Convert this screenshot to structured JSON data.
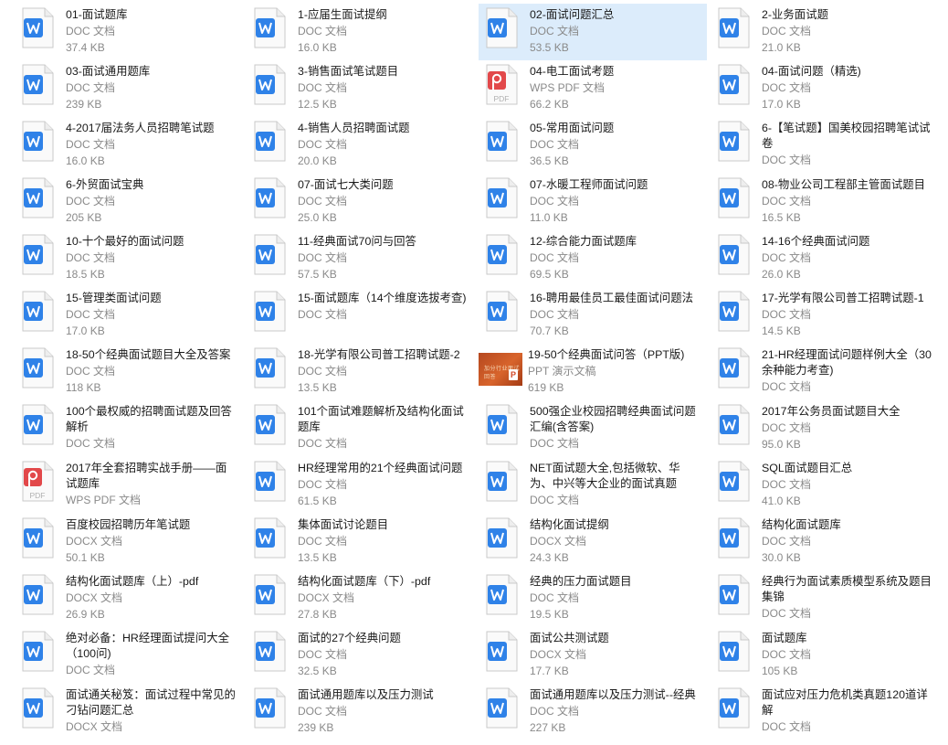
{
  "colors": {
    "selection": "#dcecfb",
    "doc_blue": "#2f82e8",
    "pdf_red": "#e2484a",
    "ppt_orange": "#d24726"
  },
  "files": [
    {
      "name": "01-面试题库",
      "type": "DOC 文档",
      "size": "37.4 KB",
      "icon": "word-doc-icon"
    },
    {
      "name": "1-应届生面试提纲",
      "type": "DOC 文档",
      "size": "16.0 KB",
      "icon": "word-doc-icon"
    },
    {
      "name": "02-面试问题汇总",
      "type": "DOC 文档",
      "size": "53.5 KB",
      "icon": "word-doc-icon",
      "selected": true
    },
    {
      "name": "2-业务面试题",
      "type": "DOC 文档",
      "size": "21.0 KB",
      "icon": "word-doc-icon"
    },
    {
      "name": "03-面试通用题库",
      "type": "DOC 文档",
      "size": "239 KB",
      "icon": "word-doc-icon"
    },
    {
      "name": "3-销售面试笔试题目",
      "type": "DOC 文档",
      "size": "12.5 KB",
      "icon": "word-doc-icon"
    },
    {
      "name": "04-电工面试考题",
      "type": "WPS PDF 文档",
      "size": "66.2 KB",
      "icon": "pdf-icon"
    },
    {
      "name": "04-面试问题（精选)",
      "type": "DOC 文档",
      "size": "17.0 KB",
      "icon": "word-doc-icon"
    },
    {
      "name": "4-2017届法务人员招聘笔试题",
      "type": "DOC 文档",
      "size": "16.0 KB",
      "icon": "word-doc-icon"
    },
    {
      "name": "4-销售人员招聘面试题",
      "type": "DOC 文档",
      "size": "20.0 KB",
      "icon": "word-doc-icon"
    },
    {
      "name": "05-常用面试问题",
      "type": "DOC 文档",
      "size": "36.5 KB",
      "icon": "word-doc-icon"
    },
    {
      "name": "6-【笔试题】国美校园招聘笔试试卷",
      "type": "DOC 文档",
      "size": "",
      "icon": "word-doc-icon"
    },
    {
      "name": "6-外贸面试宝典",
      "type": "DOC 文档",
      "size": "205 KB",
      "icon": "word-doc-icon"
    },
    {
      "name": "07-面试七大类问题",
      "type": "DOC 文档",
      "size": "25.0 KB",
      "icon": "word-doc-icon"
    },
    {
      "name": "07-水暖工程师面试问题",
      "type": "DOC 文档",
      "size": "11.0 KB",
      "icon": "word-doc-icon"
    },
    {
      "name": "08-物业公司工程部主管面试题目",
      "type": "DOC 文档",
      "size": "16.5 KB",
      "icon": "word-doc-icon"
    },
    {
      "name": "10-十个最好的面试问题",
      "type": "DOC 文档",
      "size": "18.5 KB",
      "icon": "word-doc-icon"
    },
    {
      "name": "11-经典面试70问与回答",
      "type": "DOC 文档",
      "size": "57.5 KB",
      "icon": "word-doc-icon"
    },
    {
      "name": "12-综合能力面试题库",
      "type": "DOC 文档",
      "size": "69.5 KB",
      "icon": "word-doc-icon"
    },
    {
      "name": "14-16个经典面试问题",
      "type": "DOC 文档",
      "size": "26.0 KB",
      "icon": "word-doc-icon"
    },
    {
      "name": "15-管理类面试问题",
      "type": "DOC 文档",
      "size": "17.0 KB",
      "icon": "word-doc-icon"
    },
    {
      "name": "15-面试题库（14个维度选拔考查)",
      "type": "DOC 文档",
      "size": "",
      "icon": "word-doc-icon"
    },
    {
      "name": "16-聘用最佳员工最佳面试问题法",
      "type": "DOC 文档",
      "size": "70.7 KB",
      "icon": "word-doc-icon"
    },
    {
      "name": "17-光学有限公司普工招聘试题-1",
      "type": "DOC 文档",
      "size": "14.5 KB",
      "icon": "word-doc-icon"
    },
    {
      "name": "18-50个经典面试题目大全及答案",
      "type": "DOC 文档",
      "size": "118 KB",
      "icon": "word-doc-icon"
    },
    {
      "name": "18-光学有限公司普工招聘试题-2",
      "type": "DOC 文档",
      "size": "13.5 KB",
      "icon": "word-doc-icon"
    },
    {
      "name": "19-50个经典面试问答（PPT版)",
      "type": "PPT 演示文稿",
      "size": "619 KB",
      "icon": "ppt-thumbnail-icon"
    },
    {
      "name": "21-HR经理面试问题样例大全（30余种能力考查)",
      "type": "DOC 文档",
      "size": "",
      "icon": "word-doc-icon"
    },
    {
      "name": "100个最权威的招聘面试题及回答解析",
      "type": "DOC 文档",
      "size": "",
      "icon": "word-doc-icon"
    },
    {
      "name": "101个面试难题解析及结构化面试题库",
      "type": "DOC 文档",
      "size": "",
      "icon": "word-doc-icon"
    },
    {
      "name": "500强企业校园招聘经典面试问题汇编(含答案)",
      "type": "DOC 文档",
      "size": "",
      "icon": "word-doc-icon"
    },
    {
      "name": "2017年公务员面试题目大全",
      "type": "DOC 文档",
      "size": "95.0 KB",
      "icon": "word-doc-icon"
    },
    {
      "name": "2017年全套招聘实战手册——面试题库",
      "type": "WPS PDF 文档",
      "size": "",
      "icon": "pdf-icon"
    },
    {
      "name": "HR经理常用的21个经典面试问题",
      "type": "DOC 文档",
      "size": "61.5 KB",
      "icon": "word-doc-icon"
    },
    {
      "name": "NET面试题大全,包括微软、华为、中兴等大企业的面试真题",
      "type": "DOC 文档",
      "size": "",
      "icon": "word-doc-icon"
    },
    {
      "name": "SQL面试题目汇总",
      "type": "DOC 文档",
      "size": "41.0 KB",
      "icon": "word-doc-icon"
    },
    {
      "name": "百度校园招聘历年笔试题",
      "type": "DOCX 文档",
      "size": "50.1 KB",
      "icon": "word-docx-icon"
    },
    {
      "name": "集体面试讨论题目",
      "type": "DOC 文档",
      "size": "13.5 KB",
      "icon": "word-doc-icon"
    },
    {
      "name": "结构化面试提纲",
      "type": "DOCX 文档",
      "size": "24.3 KB",
      "icon": "word-docx-icon"
    },
    {
      "name": "结构化面试题库",
      "type": "DOC 文档",
      "size": "30.0 KB",
      "icon": "word-doc-icon"
    },
    {
      "name": "结构化面试题库（上）-pdf",
      "type": "DOCX 文档",
      "size": "26.9 KB",
      "icon": "word-docx-icon"
    },
    {
      "name": "结构化面试题库（下）-pdf",
      "type": "DOCX 文档",
      "size": "27.8 KB",
      "icon": "word-docx-icon"
    },
    {
      "name": "经典的压力面试题目",
      "type": "DOC 文档",
      "size": "19.5 KB",
      "icon": "word-doc-icon"
    },
    {
      "name": "经典行为面试素质模型系统及题目集锦",
      "type": "DOC 文档",
      "size": "",
      "icon": "word-doc-icon"
    },
    {
      "name": "绝对必备：HR经理面试提问大全（100问)",
      "type": "DOC 文档",
      "size": "",
      "icon": "word-doc-icon"
    },
    {
      "name": "面试的27个经典问题",
      "type": "DOC 文档",
      "size": "32.5 KB",
      "icon": "word-doc-icon"
    },
    {
      "name": "面试公共测试题",
      "type": "DOCX 文档",
      "size": "17.7 KB",
      "icon": "word-docx-icon"
    },
    {
      "name": "面试题库",
      "type": "DOC 文档",
      "size": "105 KB",
      "icon": "word-doc-icon"
    },
    {
      "name": "面试通关秘笈：面试过程中常见的刁钻问题汇总",
      "type": "DOCX 文档",
      "size": "",
      "icon": "word-docx-icon"
    },
    {
      "name": "面试通用题库以及压力测试",
      "type": "DOC 文档",
      "size": "239 KB",
      "icon": "word-doc-icon"
    },
    {
      "name": "面试通用题库以及压力测试--经典",
      "type": "DOC 文档",
      "size": "227 KB",
      "icon": "word-doc-icon"
    },
    {
      "name": "面试应对压力危机类真题120道详解",
      "type": "DOC 文档",
      "size": "",
      "icon": "word-doc-icon"
    }
  ],
  "ppt_thumb_text": "加分行业面试回答"
}
